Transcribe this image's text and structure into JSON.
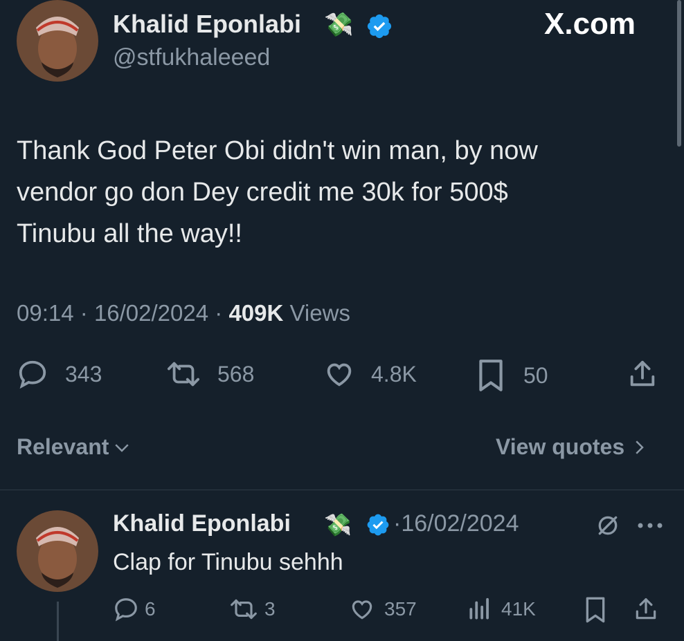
{
  "watermark": "X.com",
  "tweet": {
    "author_name": "Khalid Eponlabi",
    "author_handle": "@stfukhaleeed",
    "badge_emoji": "💸",
    "text_lines": [
      "Thank God Peter Obi didn't win man, by now",
      "vendor go don Dey credit me 30k for 500$",
      "Tinubu all the way!!"
    ],
    "time": "09:14",
    "date": "16/02/2024",
    "views_count": "409K",
    "views_label": "Views",
    "sep": "·",
    "actions": {
      "replies": "343",
      "reposts": "568",
      "likes": "4.8K",
      "bookmarks": "50"
    }
  },
  "filters": {
    "sort_label": "Relevant",
    "view_quotes_label": "View quotes"
  },
  "reply": {
    "author_name": "Khalid Eponlabi",
    "badge_emoji": "💸",
    "sep": "·",
    "date": "16/02/2024",
    "text": "Clap for Tinubu sehhh",
    "actions": {
      "replies": "6",
      "reposts": "3",
      "likes": "357",
      "views": "41K"
    }
  },
  "colors": {
    "background": "#15202b",
    "text": "#e7e9ea",
    "secondary": "#8b98a5",
    "verified": "#1d9bf0"
  },
  "icons": [
    "verified-badge-icon",
    "reply-icon",
    "repost-icon",
    "like-icon",
    "bookmark-icon",
    "share-icon",
    "chevron-down-icon",
    "chevron-right-icon",
    "views-icon",
    "grok-icon",
    "more-icon"
  ]
}
